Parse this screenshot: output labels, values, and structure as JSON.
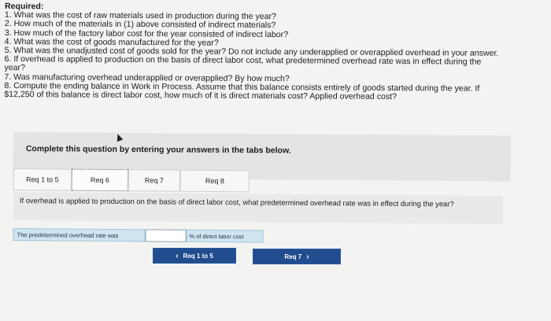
{
  "required": {
    "heading": "Required:",
    "items": [
      "1. What was the cost of raw materials used in production during the year?",
      "2. How much of the materials in (1) above consisted of indirect materials?",
      "3. How much of the factory labor cost for the year consisted of indirect labor?",
      "4. What was the cost of goods manufactured for the year?",
      "5. What was the unadjusted cost of goods sold for the year? Do not include any underapplied or overapplied overhead in your answer.",
      "6. If overhead is applied to production on the basis of direct labor cost, what predetermined overhead rate was in effect during the",
      "year?",
      "7. Was manufacturing overhead underapplied or overapplied? By how much?",
      "8. Compute the ending balance in Work in Process. Assume that this balance consists entirely of goods started during the year. If",
      "$12,250 of this balance is direct labor cost, how much of it is direct materials cost? Applied overhead cost?"
    ]
  },
  "question_box": {
    "prompt": "Complete this question by entering your answers in the tabs below."
  },
  "tabs": [
    {
      "label": "Req 1 to 5"
    },
    {
      "label": "Req 6"
    },
    {
      "label": "Req 7"
    },
    {
      "label": "Req 8"
    }
  ],
  "active_tab": "Req 6",
  "content": {
    "question": "If overhead is applied to production on the basis of direct labor cost, what predetermined overhead rate was in effect during the year?",
    "answer_label": "The predetermined overhead rate was",
    "answer_value": "",
    "answer_unit": "% of direct labor cost"
  },
  "nav": {
    "prev_label": "Req 1 to 5",
    "next_label": "Req 7"
  },
  "colors": {
    "nav_button": "#214d8f",
    "answer_label_bg": "#cfe4f1"
  }
}
